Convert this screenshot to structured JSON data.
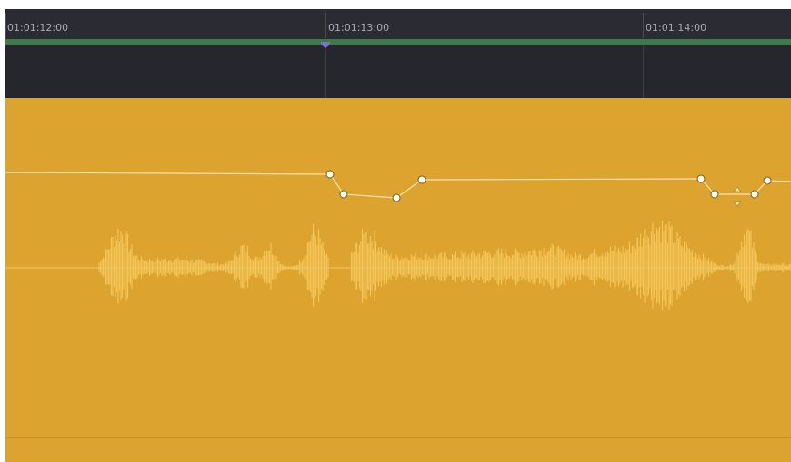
{
  "ruler": {
    "timecodes": [
      "01:01:12:00",
      "01:01:13:00",
      "01:01:14:00"
    ]
  },
  "colors": {
    "ruler_bg": "#2a2c31",
    "range_bar": "#3f7a4a",
    "track_header_bg": "#25272c",
    "clip_fill": "#dca42f",
    "waveform": "#f5c558",
    "volume_curve": "#f3e3b4",
    "keyframe_fill": "#ffffff",
    "playhead_marker": "#7b6fd0"
  },
  "icons": {
    "playhead": "playhead-marker-icon",
    "keyframe": "keyframe-dot-icon",
    "nudge_up": "nudge-up-icon",
    "nudge_down": "nudge-down-icon"
  }
}
